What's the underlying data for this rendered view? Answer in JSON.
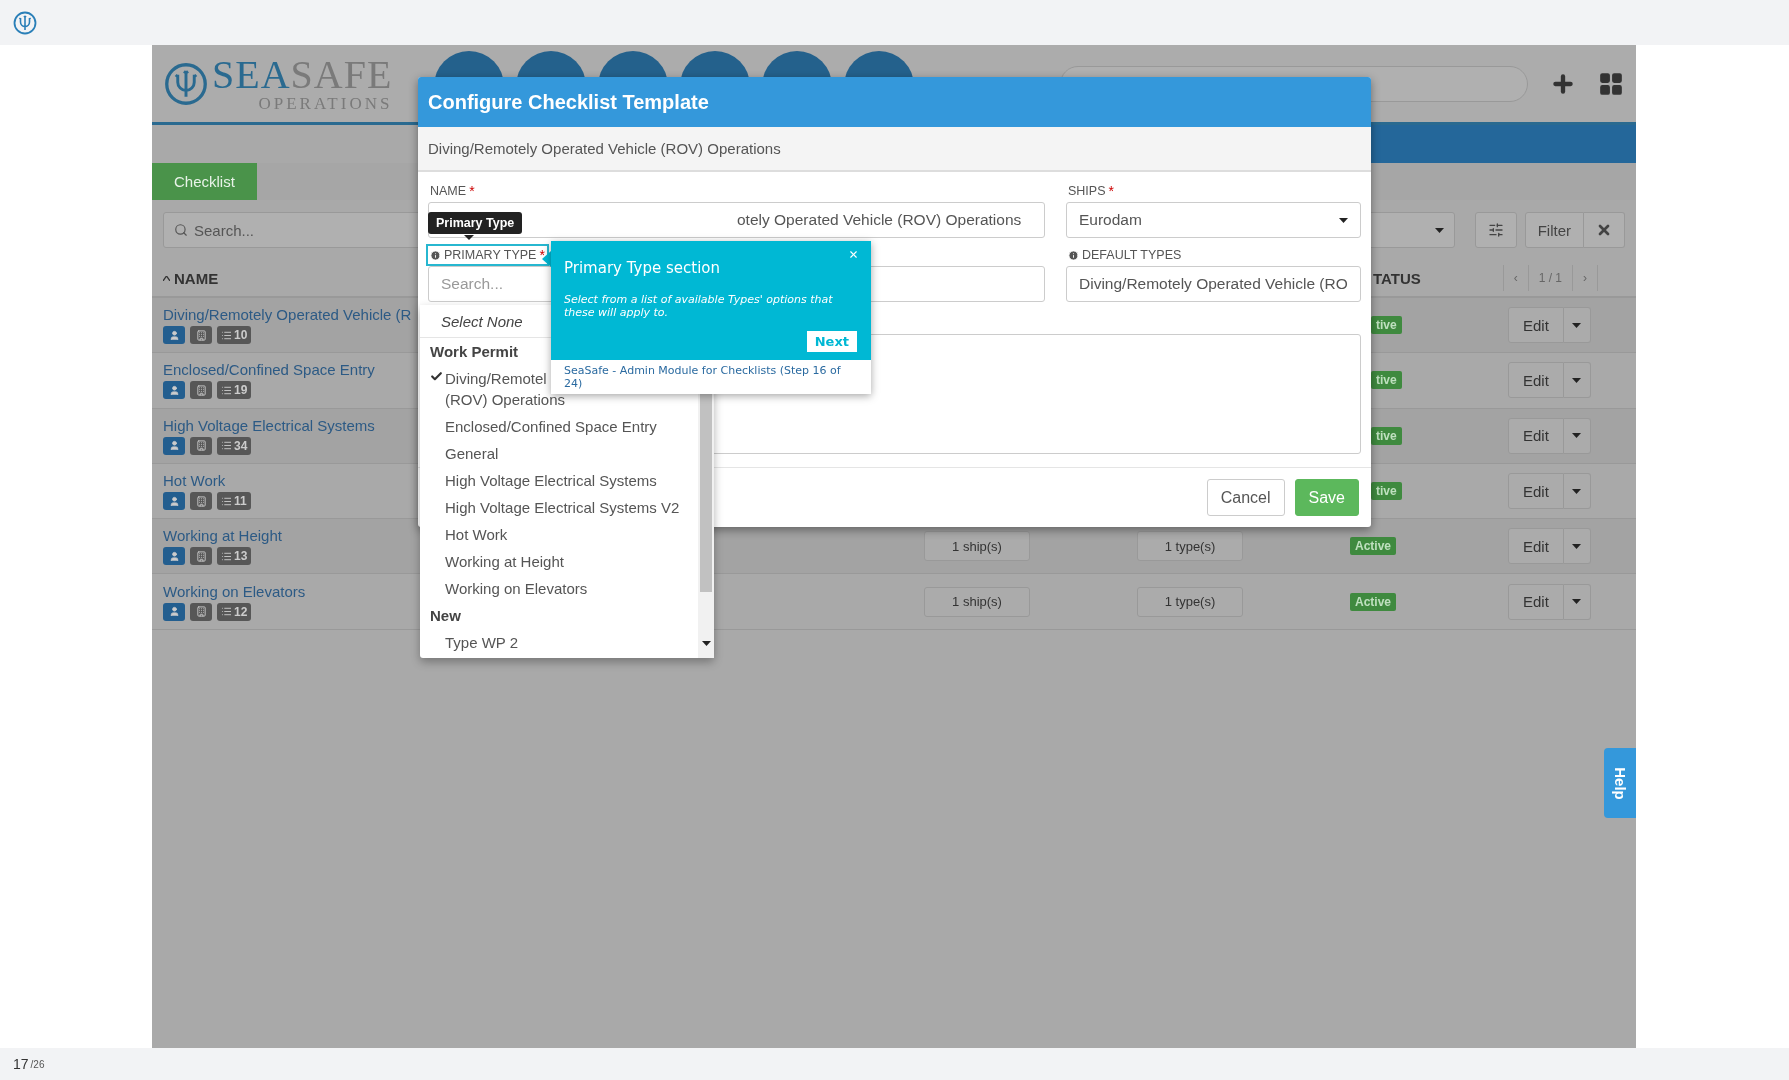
{
  "header": {
    "wordmark_lead": "SEA",
    "wordmark_rest": "SAFE",
    "tagline": "OPERATIONS"
  },
  "tabs": [
    {
      "label": "Checklist",
      "selected": true
    }
  ],
  "list_toolbar": {
    "search_placeholder": "Search...",
    "filter_button": "Filter"
  },
  "table": {
    "columns": [
      {
        "label": "NAME",
        "sorted": true
      },
      {
        "label": "TATUS",
        "sorted": false
      }
    ],
    "pagination": {
      "prev": "‹",
      "page": "1 / 1",
      "next": "›"
    },
    "rows": [
      {
        "name": "Diving/Remotely Operated Vehicle (R",
        "count": "10",
        "status": "tive",
        "edit": "Edit"
      },
      {
        "name": "Enclosed/Confined Space Entry",
        "count": "19",
        "status": "tive",
        "edit": "Edit"
      },
      {
        "name": "High Voltage Electrical Systems",
        "count": "34",
        "status": "tive",
        "edit": "Edit"
      },
      {
        "name": "Hot Work",
        "count": "11",
        "status": "tive",
        "edit": "Edit"
      },
      {
        "name": "Working at Height",
        "count": "13",
        "ships": "1 ship(s)",
        "types": "1 type(s)",
        "status": "Active",
        "edit": "Edit"
      },
      {
        "name": "Working on Elevators",
        "count": "12",
        "ships": "1 ship(s)",
        "types": "1 type(s)",
        "status": "Active",
        "edit": "Edit"
      }
    ]
  },
  "modal": {
    "title": "Configure Checklist Template",
    "subtitle": "Diving/Remotely Operated Vehicle (ROV) Operations",
    "fields": [
      {
        "kind": "text",
        "label": "NAME",
        "marker": "*",
        "value": "otely Operated Vehicle (ROV) Operations"
      },
      {
        "kind": "select",
        "label": "SHIPS",
        "marker": "*",
        "value": "Eurodam"
      },
      {
        "kind": "search",
        "label": "PRIMARY TYPE",
        "marker": "*",
        "info": true,
        "highlighted": true,
        "placeholder": "Search..."
      },
      {
        "kind": "select"
      },
      {
        "kind": "select",
        "label": "DEFAULT TYPES",
        "info": true,
        "value": "Diving/Remotely Operated Vehicle (RO"
      },
      {
        "kind": "textarea"
      }
    ],
    "buttons": [
      {
        "label": "Cancel",
        "kind": "default"
      },
      {
        "label": "Save",
        "kind": "primary"
      }
    ]
  },
  "dropdown": {
    "options": [
      {
        "kind": "none",
        "label": "Select None"
      },
      {
        "kind": "group",
        "label": "Work Permit"
      },
      {
        "kind": "option",
        "label": "Diving/Remotel\n(ROV) Operations",
        "selected": true
      },
      {
        "kind": "option",
        "label": "Enclosed/Confined Space Entry",
        "selected": false
      },
      {
        "kind": "option",
        "label": "General",
        "selected": false
      },
      {
        "kind": "option",
        "label": "High Voltage Electrical Systems",
        "selected": false
      },
      {
        "kind": "option",
        "label": "High Voltage Electrical Systems V2",
        "selected": false
      },
      {
        "kind": "option",
        "label": "Hot Work",
        "selected": false
      },
      {
        "kind": "option",
        "label": "Working at Height",
        "selected": false
      },
      {
        "kind": "option",
        "label": "Working on Elevators",
        "selected": false
      },
      {
        "kind": "group",
        "label": "New"
      },
      {
        "kind": "option",
        "label": "Type WP 2",
        "selected": false
      }
    ]
  },
  "tooltip": {
    "text": "Primary Type"
  },
  "tour": {
    "title": "Primary Type section",
    "body": "Select from a list of available Types' options that these will apply to.",
    "next": "Next",
    "footer": "SeaSafe - Admin Module for Checklists (Step 16 of 24)"
  },
  "help": {
    "label": "Help"
  },
  "pager": {
    "current": "17",
    "total": "/26"
  }
}
